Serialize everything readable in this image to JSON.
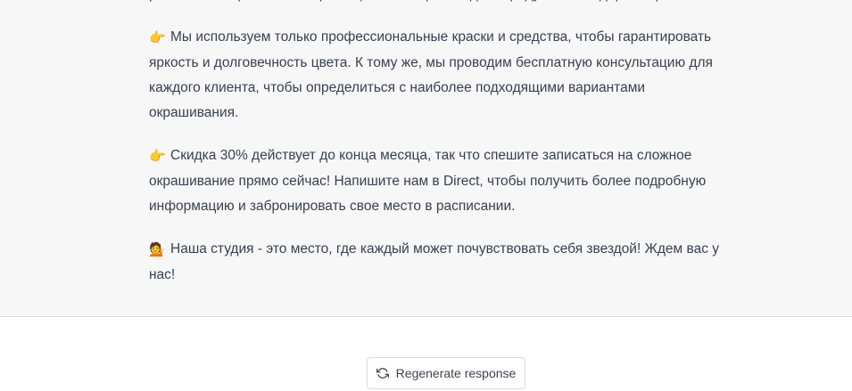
{
  "message": {
    "paragraphs": [
      {
        "emoji": "",
        "text": "рый легко стирается, а о ярком цвете, который надолго радует глаз и дарит хорошее настроение."
      },
      {
        "emoji": "👉",
        "text": "Мы используем только профессиональные краски и средства, чтобы гарантировать яркость и долговечность цвета. К тому же, мы проводим бесплатную консультацию для каждого клиента, чтобы определиться с наиболее подходящими вариантами окрашивания."
      },
      {
        "emoji": "👉",
        "text": "Скидка 30% действует до конца месяца, так что спешите записаться на сложное окрашивание прямо сейчас! Напишите нам в Direct, чтобы получить более подробную информацию и забронировать свое место в расписании."
      },
      {
        "emoji": "💁",
        "text": "Наша студия - это место, где каждый может почувствовать себя звездой! Ждем вас у нас!"
      }
    ]
  },
  "actions": {
    "regenerate_label": "Regenerate response",
    "regenerate_icon": "refresh-icon"
  },
  "colors": {
    "message_bg": "#f7f7f8",
    "text": "#374151",
    "border": "#d9d9e3"
  }
}
